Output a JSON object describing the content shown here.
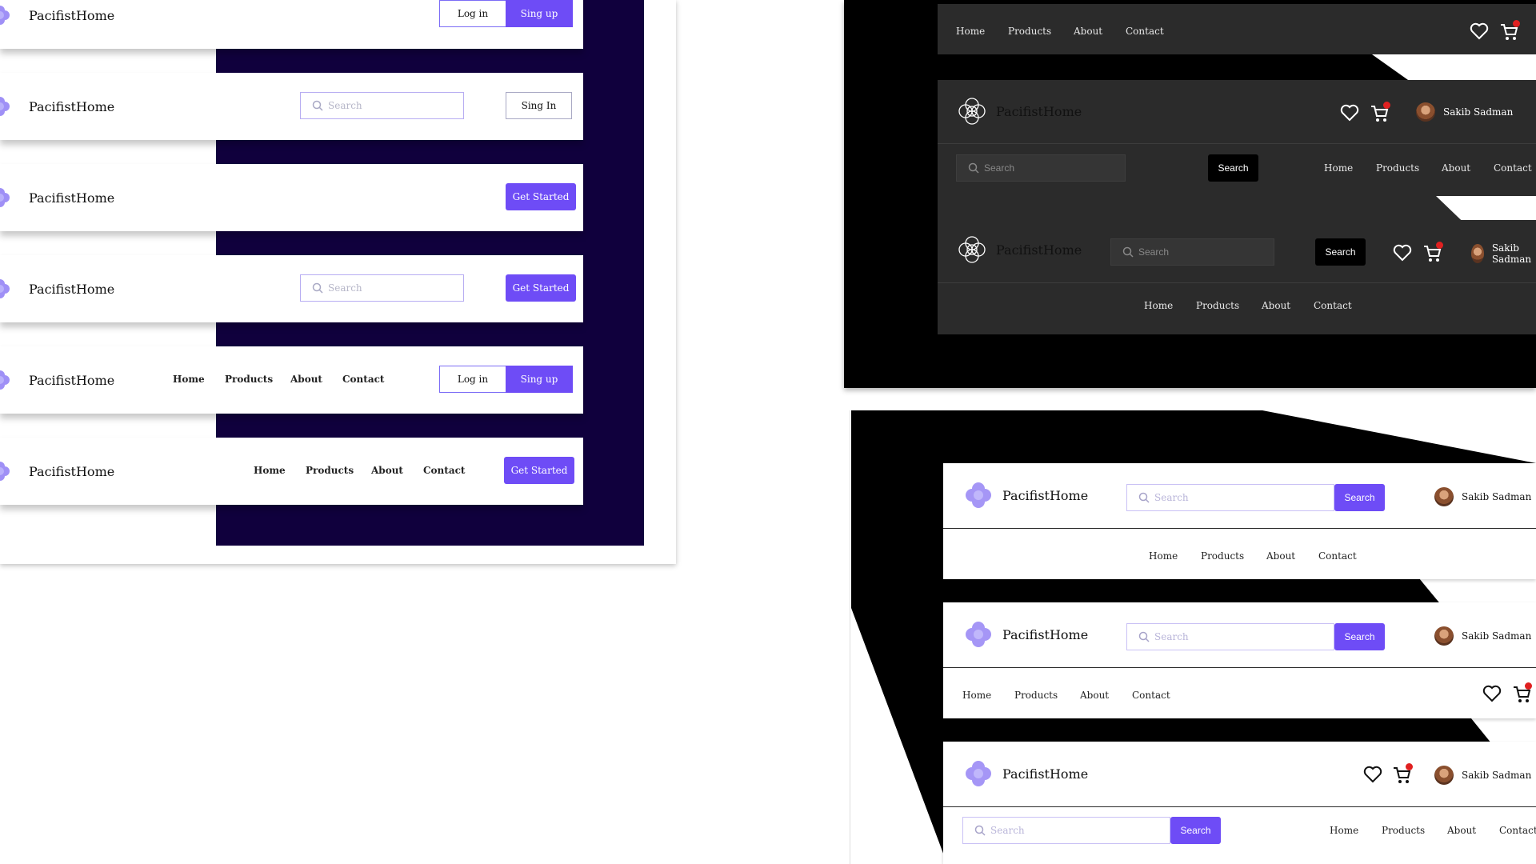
{
  "brand": {
    "name": "PacifistHome"
  },
  "left_navbars": [
    {
      "search_placeholder": "",
      "login": "Log in",
      "signup": "Sing up"
    },
    {
      "search_placeholder": "Search",
      "signin": "Sing In"
    },
    {
      "cta": "Get Started"
    },
    {
      "search_placeholder": "Search",
      "cta": "Get Started"
    },
    {
      "links": [
        "Home",
        "Products",
        "About",
        "Contact"
      ],
      "login": "Log in",
      "signup": "Sing up"
    },
    {
      "links": [
        "Home",
        "Products",
        "About",
        "Contact"
      ],
      "cta": "Get Started"
    }
  ],
  "dark_navbars": {
    "nav1": {
      "links": [
        "Home",
        "Products",
        "About",
        "Contact"
      ]
    },
    "nav2": {
      "search_placeholder": "Search",
      "search_button": "Search",
      "user": "Sakib Sadman",
      "links": [
        "Home",
        "Products",
        "About",
        "Contact"
      ]
    },
    "nav3": {
      "search_placeholder": "Search",
      "search_button": "Search",
      "user": "Sakib Sadman",
      "links": [
        "Home",
        "Products",
        "About",
        "Contact"
      ]
    }
  },
  "light_navbars": {
    "nav1": {
      "search_placeholder": "Search",
      "search_button": "Search",
      "user": "Sakib Sadman",
      "links": [
        "Home",
        "Products",
        "About",
        "Contact"
      ]
    },
    "nav2": {
      "search_placeholder": "Search",
      "search_button": "Search",
      "user": "Sakib Sadman",
      "links": [
        "Home",
        "Products",
        "About",
        "Contact"
      ]
    },
    "nav3": {
      "search_placeholder": "Search",
      "search_button": "Search",
      "user": "Sakib Sadman",
      "links": [
        "Home",
        "Products",
        "About",
        "Contact"
      ]
    }
  },
  "icons": [
    "logo-icon",
    "search-icon",
    "heart-icon",
    "cart-icon",
    "avatar"
  ],
  "colors": {
    "accent": "#6e4cf6",
    "navy": "#10003d",
    "dark_panel": "#2b2b2b",
    "badge": "#e02020"
  }
}
